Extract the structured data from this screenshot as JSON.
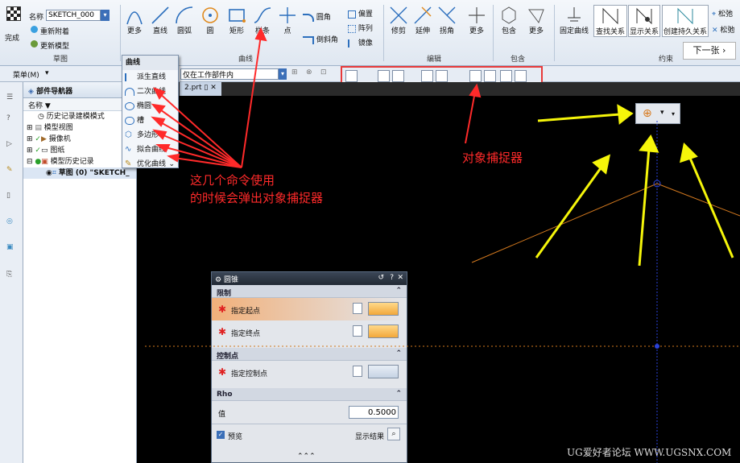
{
  "ribbon": {
    "sketch_name_label": "名称",
    "sketch_name_value": "SKETCH_000",
    "finish_label": "完成",
    "reattach_label": "重新附着",
    "update_model_label": "更新模型",
    "sketch_group": "草图",
    "curve_group": "曲线",
    "edit_group": "编辑",
    "constraint_group": "约束",
    "include_group": "包含",
    "buttons": {
      "more1": "更多",
      "line": "直线",
      "arc": "圆弧",
      "circle": "圆",
      "rectangle": "矩形",
      "spline": "样条",
      "point": "点",
      "fillet": "圆角",
      "chamfer": "倒斜角",
      "offset": "偏置",
      "array": "阵列",
      "mirror": "镜像",
      "trim": "修剪",
      "extend": "延伸",
      "corner": "拐角",
      "more2": "更多",
      "include": "包含",
      "more3": "更多",
      "fixed_curve": "固定曲线",
      "find_relations": "查找关系",
      "show_relations": "显示关系",
      "create_persistent": "创建持久关系",
      "relax1": "松弛",
      "relax2": "松弛"
    },
    "next_page": "下一张 ›"
  },
  "bar2": {
    "menu_label": "菜单(M)",
    "filter_value": "仅在工作部件内"
  },
  "navigator": {
    "title": "部件导航器",
    "col_name": "名称",
    "items": [
      {
        "label": "历史记录建模模式"
      },
      {
        "label": "模型视图"
      },
      {
        "label": "摄像机"
      },
      {
        "label": "图纸"
      },
      {
        "label": "模型历史记录"
      },
      {
        "label": "草图 (0) \"SKETCH_"
      }
    ]
  },
  "tab": {
    "label": "2.prt"
  },
  "dropdown": {
    "header": "曲线",
    "items": [
      {
        "label": "派生直线"
      },
      {
        "label": "二次曲线"
      },
      {
        "label": "椭圆"
      },
      {
        "label": "槽"
      },
      {
        "label": "多边形"
      },
      {
        "label": "拟合曲线"
      },
      {
        "label": "优化曲线"
      }
    ]
  },
  "annotations": {
    "left_line1": "这几个命令使用",
    "left_line2": "的时候会弹出对象捕捉器",
    "snap_label": "对象捕捉器"
  },
  "dialog": {
    "title": "圆锥",
    "section_limits": "限制",
    "start_point": "指定起点",
    "end_point": "指定终点",
    "section_control": "控制点",
    "control_point": "指定控制点",
    "section_rho": "Rho",
    "value_label": "值",
    "value": "0.5000",
    "preview_label": "预览",
    "show_result": "显示结果"
  },
  "watermark": "UG爱好者论坛 WWW.UGSNX.COM",
  "colors": {
    "annotation_red": "#ff2a2a",
    "arrow_yellow": "#f5f50a",
    "highlight_box": "#e83a3a",
    "orange_line": "#d2781e",
    "blue_axis": "#2a42d8"
  }
}
